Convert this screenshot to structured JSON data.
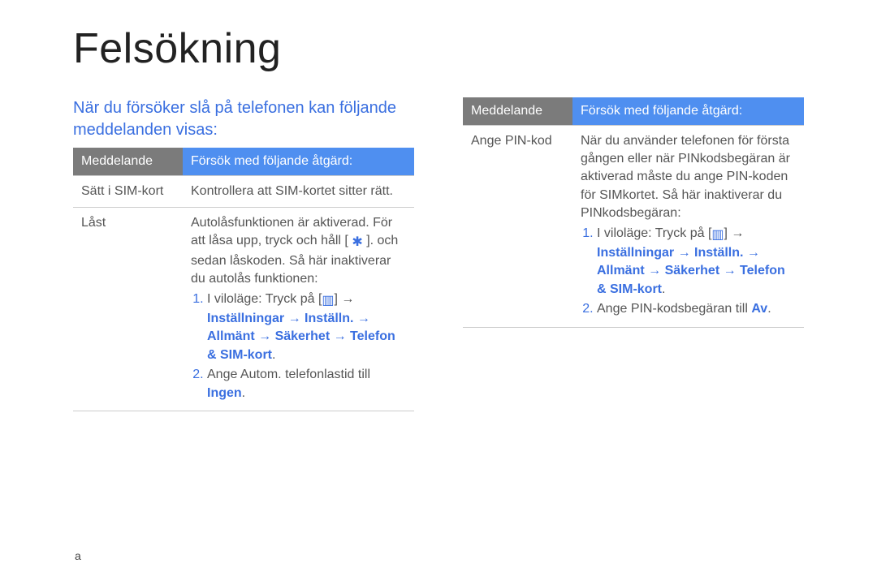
{
  "title": "Felsökning",
  "intro": "När du försöker slå på telefonen kan följande meddelanden visas:",
  "headers": {
    "message": "Meddelande",
    "action": "Försök med följande åtgärd:"
  },
  "left_table": {
    "rows": [
      {
        "msg": "Sätt i SIM-kort",
        "action_plain": "Kontrollera att SIM-kortet sitter rätt."
      },
      {
        "msg": "Låst",
        "action_intro": "Autolåsfunktionen är aktiverad. För att låsa upp, tryck och håll [",
        "action_intro_after": "]. och sedan låskoden. Så här inaktiverar du autolås funktionen:",
        "step1_plain_prefix": "I viloläge: Tryck på [",
        "step1_plain_suffix": "] → ",
        "step1_bold": "Inställningar → Inställn. → Allmänt → Säkerhet → Telefon & SIM-kort",
        "step1_bold_tail": ".",
        "step2_plain": "Ange Autom. telefonlastid till ",
        "step2_bold": "Ingen",
        "step2_tail": "."
      }
    ]
  },
  "right_table": {
    "rows": [
      {
        "msg": "Ange PIN-kod",
        "action_intro": "När du använder telefonen för första gången eller när PINkodsbegäran är aktiverad måste du ange PIN-koden för SIMkortet. Så här inaktiverar du PINkodsbegäran:",
        "step1_plain_prefix": "I viloläge: Tryck på [",
        "step1_plain_suffix": "] → ",
        "step1_bold": "Inställningar → Inställn. → Allmänt → Säkerhet → Telefon & SIM-kort",
        "step1_bold_tail": ".",
        "step2_plain": "Ange PIN-kodsbegäran till ",
        "step2_bold": "Av",
        "step2_tail": "."
      }
    ]
  },
  "icons": {
    "star": "✱",
    "menu": "▥"
  },
  "footer": "a"
}
